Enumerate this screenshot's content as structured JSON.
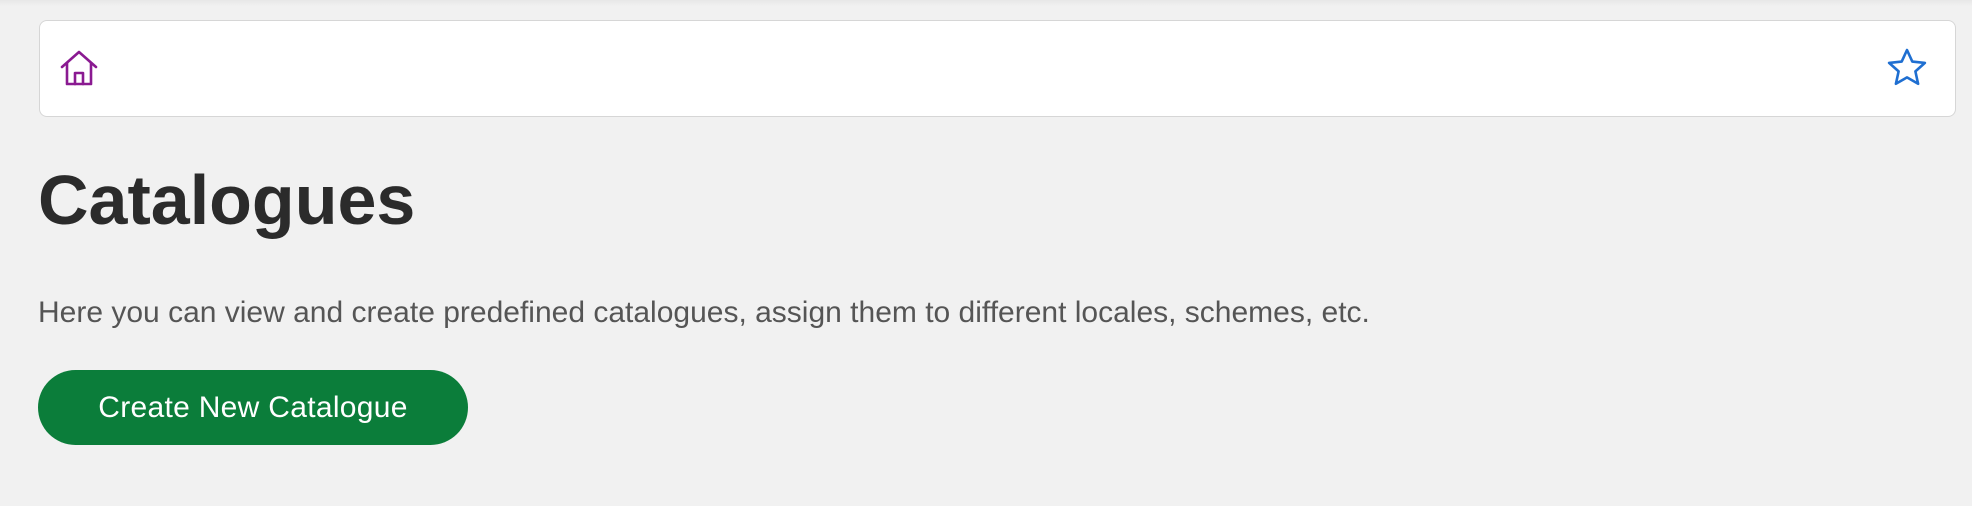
{
  "header": {
    "home_icon": "home-icon",
    "favorite_icon": "star-outline-icon"
  },
  "page": {
    "title": "Catalogues",
    "description": "Here you can view and create predefined catalogues, assign them to different locales, schemes, etc.",
    "create_button_label": "Create New Catalogue"
  },
  "colors": {
    "background": "#f1f1f1",
    "home_icon": "#8a1a91",
    "star_icon": "#1f6fd1",
    "primary_button": "#0b7d3a",
    "title_text": "#2b2b2b",
    "body_text": "#555555"
  }
}
